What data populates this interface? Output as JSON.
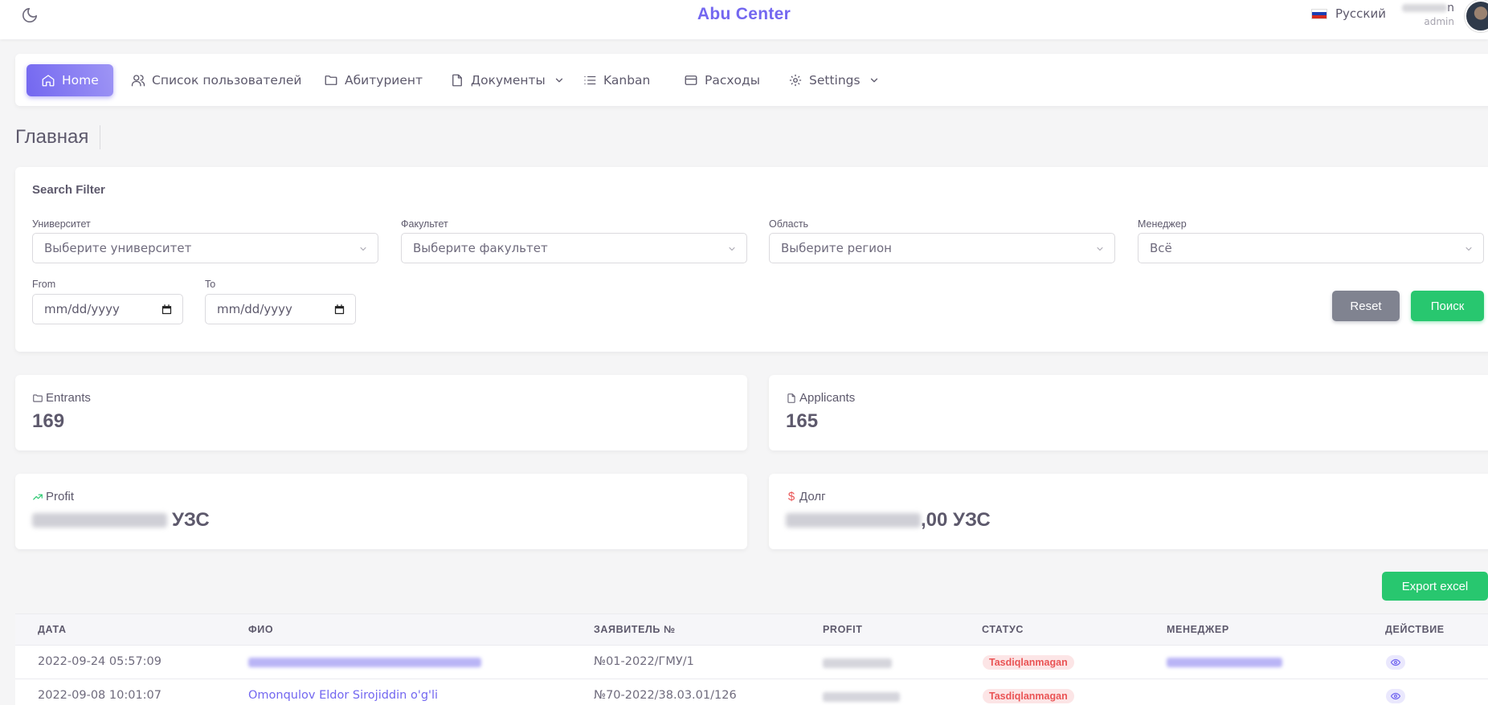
{
  "topbar": {
    "brand": "Abu Center",
    "language": "Русский",
    "user_role": "admin",
    "user_name_suffix": "n"
  },
  "nav": {
    "items": [
      {
        "label": "Home"
      },
      {
        "label": "Список пользователей"
      },
      {
        "label": "Абитуриент"
      },
      {
        "label": "Документы"
      },
      {
        "label": "Kanban"
      },
      {
        "label": "Расходы"
      },
      {
        "label": "Settings"
      }
    ]
  },
  "page": {
    "title": "Главная"
  },
  "filter": {
    "title": "Search Filter",
    "university": {
      "label": "Университет",
      "placeholder": "Выберите университет"
    },
    "faculty": {
      "label": "Факультет",
      "placeholder": "Выберите факультет"
    },
    "region": {
      "label": "Область",
      "placeholder": "Выберите регион"
    },
    "manager": {
      "label": "Менеджер",
      "value": "Всё"
    },
    "from": {
      "label": "From",
      "placeholder": "mm/dd/yyyy"
    },
    "to": {
      "label": "To",
      "placeholder": "mm/dd/yyyy"
    },
    "reset_label": "Reset",
    "search_label": "Поиск"
  },
  "stats": {
    "entrants": {
      "label": "Entrants",
      "value": "169"
    },
    "applicants": {
      "label": "Applicants",
      "value": "165"
    },
    "profit": {
      "label": "Profit",
      "visible_suffix": "УЗС"
    },
    "debt": {
      "label": "Долг",
      "visible_suffix": ",00 УЗС"
    }
  },
  "export_label": "Export excel",
  "table": {
    "headers": [
      "ДАТА",
      "ФИО",
      "ЗАЯВИТЕЛЬ №",
      "PROFIT",
      "СТАТУС",
      "МЕНЕДЖЕР",
      "ДЕЙСТВИЕ"
    ],
    "rows": [
      {
        "date": "2022-09-24 05:57:09",
        "applicant_no": "№01-2022/ГМУ/1",
        "status": "Tasdiqlanmagan"
      },
      {
        "date": "2022-09-08 10:01:07",
        "name": "Omonqulov Eldor Sirojiddin o'g'li",
        "applicant_no": "№70-2022/38.03.01/126",
        "status": "Tasdiqlanmagan"
      }
    ]
  },
  "colors": {
    "primary": "#7367f0",
    "success": "#28c76f",
    "secondary": "#808390",
    "danger": "#ea5455"
  }
}
